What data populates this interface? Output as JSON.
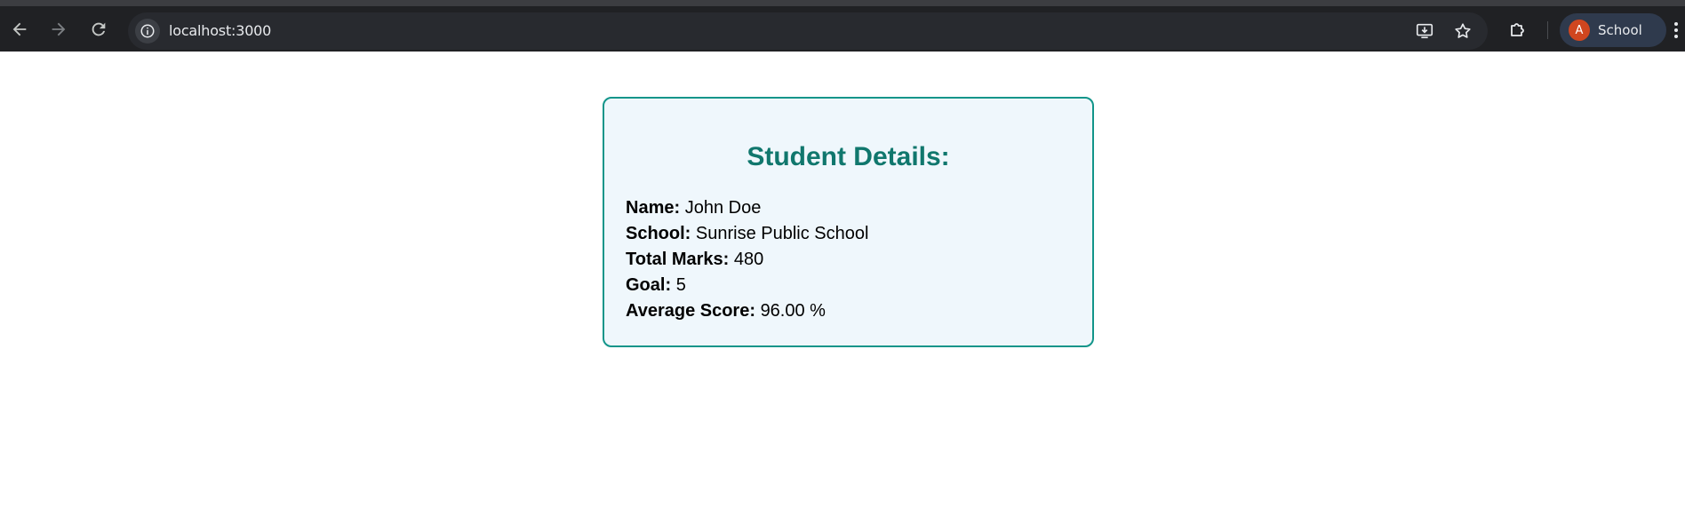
{
  "browser": {
    "url": "localhost:3000",
    "profile": {
      "initial": "A",
      "name": "School"
    },
    "colors": {
      "toolbar": "#202124",
      "omnibox": "#282a2f",
      "avatar": "#d0461f",
      "profile_chip": "#2f3a4d"
    },
    "icons": [
      "back-arrow-icon",
      "forward-arrow-icon",
      "reload-icon",
      "info-icon",
      "install-app-icon",
      "star-icon",
      "puzzle-extensions-icon",
      "kebab-menu-icon"
    ]
  },
  "card": {
    "title": "Student Details:",
    "colors": {
      "border": "#12958a",
      "title": "#10776d",
      "background": "#eff7fc"
    },
    "details": [
      {
        "label": "Name:",
        "value": "John Doe"
      },
      {
        "label": "School:",
        "value": "Sunrise Public School"
      },
      {
        "label": "Total Marks:",
        "value": "480"
      },
      {
        "label": "Goal:",
        "value": "5"
      },
      {
        "label": "Average Score:",
        "value": "96.00 %"
      }
    ]
  }
}
